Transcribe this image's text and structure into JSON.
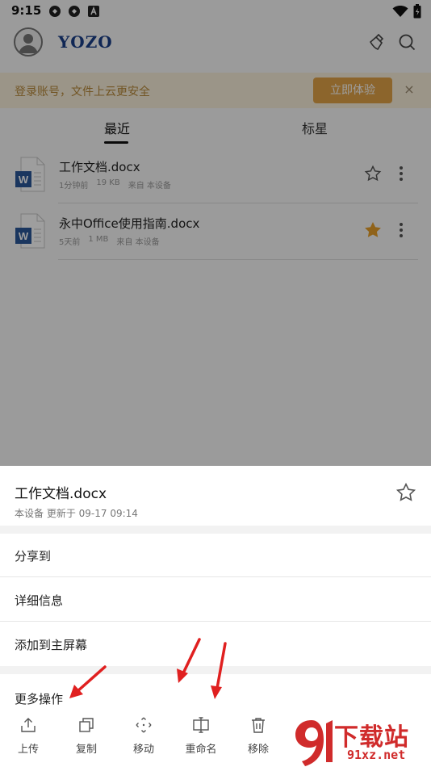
{
  "status_bar": {
    "time": "9:15"
  },
  "header": {
    "logo": "YOZO"
  },
  "banner": {
    "message": "登录账号，文件上云更安全",
    "action": "立即体验",
    "close": "×"
  },
  "tabs": [
    {
      "label": "最近",
      "active": true
    },
    {
      "label": "标星",
      "active": false
    }
  ],
  "files": [
    {
      "name": "工作文档.docx",
      "time": "1分钟前",
      "size": "19 KB",
      "source": "来自 本设备",
      "starred": false
    },
    {
      "name": "永中Office使用指南.docx",
      "time": "5天前",
      "size": "1 MB",
      "source": "来自 本设备",
      "starred": true
    }
  ],
  "sheet": {
    "title": "工作文档.docx",
    "subtitle": "本设备 更新于 09-17 09:14",
    "items": [
      {
        "label": "分享到"
      },
      {
        "label": "详细信息"
      },
      {
        "label": "添加到主屏幕"
      }
    ],
    "more_title": "更多操作",
    "ops": [
      {
        "label": "上传",
        "icon": "upload-icon"
      },
      {
        "label": "复制",
        "icon": "copy-icon"
      },
      {
        "label": "移动",
        "icon": "move-icon"
      },
      {
        "label": "重命名",
        "icon": "rename-icon"
      },
      {
        "label": "移除",
        "icon": "trash-icon"
      }
    ]
  },
  "watermark": {
    "brand": "下载站",
    "url": "91xz.net"
  },
  "colors": {
    "accent_orange": "#e2a348",
    "banner_bg": "#fbf1dc",
    "star_gold": "#e8a12a",
    "word_blue": "#2b579a",
    "arrow_red": "#e02020"
  }
}
